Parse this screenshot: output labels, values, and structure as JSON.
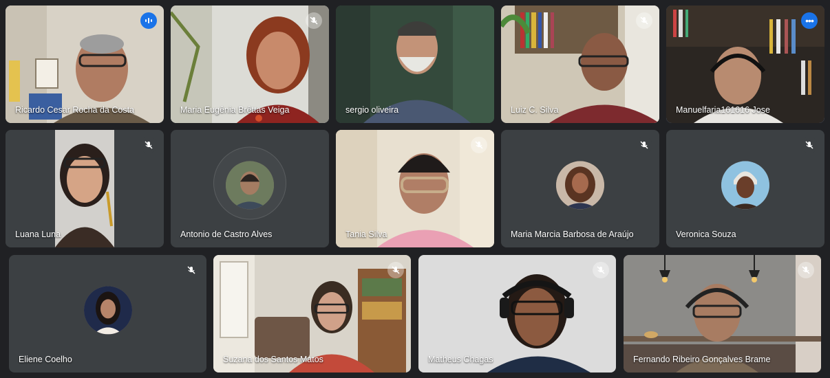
{
  "participants": [
    {
      "name": "Ricardo Cesar Rocha da Costa",
      "status": "speaking"
    },
    {
      "name": "Maria Eugênia Brêttas Veiga",
      "status": "muted"
    },
    {
      "name": "sergio oliveira",
      "status": "unmuted"
    },
    {
      "name": "Luiz C. Silva",
      "status": "muted"
    },
    {
      "name": "Manuelfaria161616 Jose",
      "status": "more-options"
    },
    {
      "name": "Luana Luna",
      "status": "muted"
    },
    {
      "name": "Antonio de Castro Alves",
      "status": "unmuted"
    },
    {
      "name": "Tania Silva",
      "status": "muted"
    },
    {
      "name": "Maria Marcia Barbosa de Araújo",
      "status": "muted"
    },
    {
      "name": "Veronica Souza",
      "status": "muted"
    },
    {
      "name": "Eliene Coelho",
      "status": "muted"
    },
    {
      "name": "Suzana dos Santos Matos",
      "status": "muted"
    },
    {
      "name": "Matheus Chagas",
      "status": "muted"
    },
    {
      "name": "Fernando Ribeiro Gonçalves Brame",
      "status": "muted"
    }
  ],
  "colors": {
    "background": "#202124",
    "tile": "#3c4043",
    "accent": "#1a73e8",
    "active_border": "#8ab4f8"
  },
  "icons": {
    "muted": "mic-off-icon",
    "speaking": "audio-level-icon",
    "more": "more-options-icon"
  }
}
